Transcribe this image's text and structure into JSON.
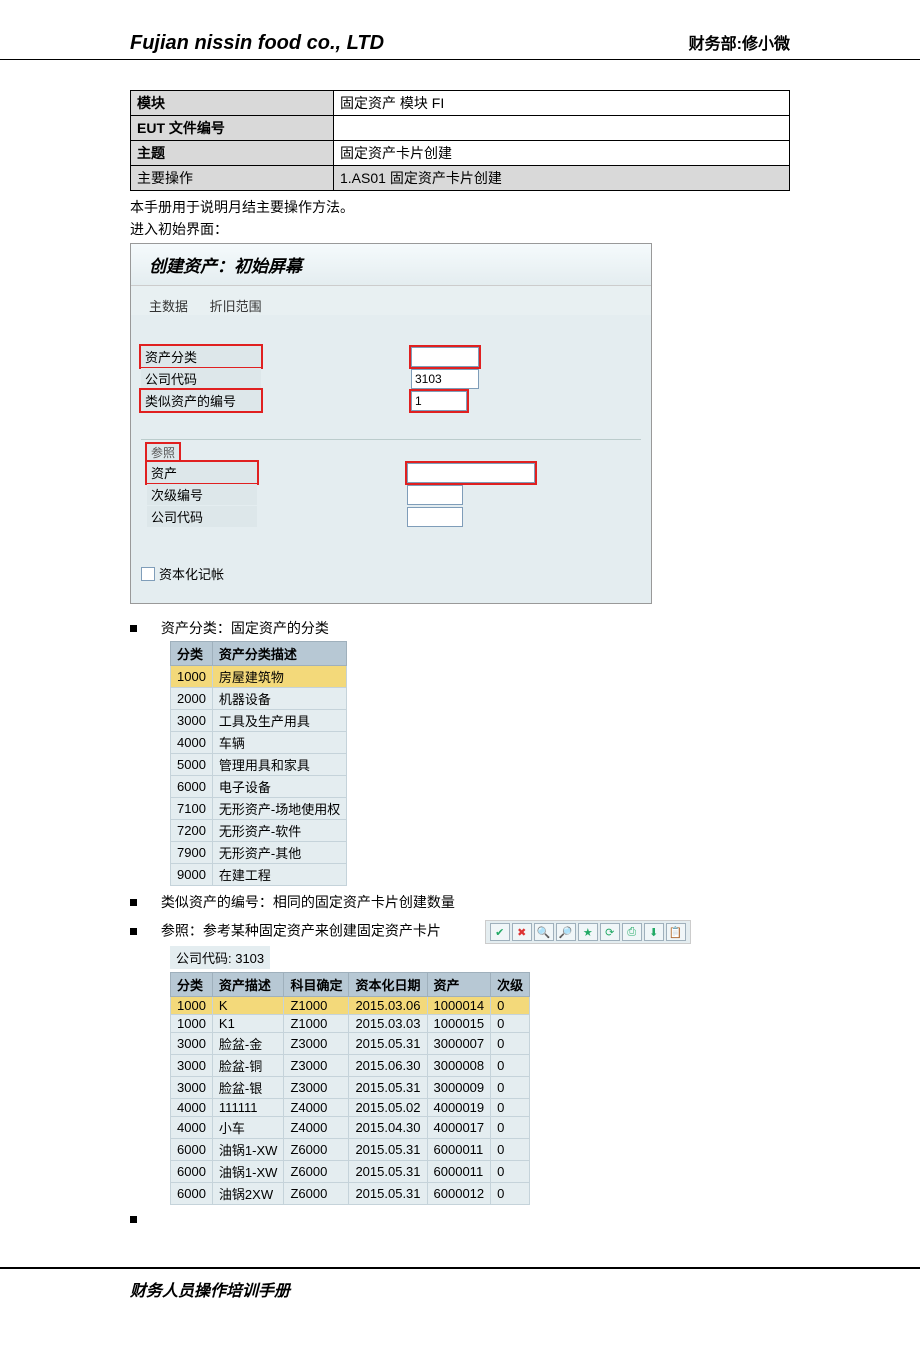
{
  "header": {
    "company": "Fujian nissin food co., LTD",
    "dept": "财务部:修小微"
  },
  "meta": {
    "module_label": "模块",
    "module_value": "固定资产 模块 FI",
    "eut_label": "EUT 文件编号",
    "eut_value": "",
    "subject_label": "主题",
    "subject_value": "固定资产卡片创建",
    "op_label": "主要操作",
    "op_value": "1.AS01 固定资产卡片创建"
  },
  "intro_line1": "本手册用于说明月结主要操作方法。",
  "intro_line2": "进入初始界面：",
  "sap_screen": {
    "title": "创建资产：初始屏幕",
    "tab_main": "主数据",
    "tab_depr": "折旧范围",
    "asset_class_label": "资产分类",
    "company_code_label": "公司代码",
    "company_code_value": "3103",
    "similar_asset_label": "类似资产的编号",
    "similar_asset_value": "1",
    "ref_header": "参照",
    "ref_asset_label": "资产",
    "ref_subno_label": "次级编号",
    "ref_company_label": "公司代码",
    "capitalize_label": "资本化记帐"
  },
  "bullets": {
    "b1": "资产分类：固定资产的分类",
    "b2": "类似资产的编号：相同的固定资产卡片创建数量",
    "b3": "参照：参考某种固定资产来创建固定资产卡片"
  },
  "class_table": {
    "h1": "分类",
    "h2": "资产分类描述",
    "rows": [
      {
        "c1": "1000",
        "c2": "房屋建筑物"
      },
      {
        "c1": "2000",
        "c2": "机器设备"
      },
      {
        "c1": "3000",
        "c2": "工具及生产用具"
      },
      {
        "c1": "4000",
        "c2": "车辆"
      },
      {
        "c1": "5000",
        "c2": "管理用具和家具"
      },
      {
        "c1": "6000",
        "c2": "电子设备"
      },
      {
        "c1": "7100",
        "c2": "无形资产-场地使用权"
      },
      {
        "c1": "7200",
        "c2": "无形资产-软件"
      },
      {
        "c1": "7900",
        "c2": "无形资产-其他"
      },
      {
        "c1": "9000",
        "c2": "在建工程"
      }
    ]
  },
  "company_code_line": "公司代码: 3103",
  "asset_list": {
    "h1": "分类",
    "h2": "资产描述",
    "h3": "科目确定",
    "h4": "资本化日期",
    "h5": "资产",
    "h6": "次级",
    "rows": [
      {
        "c1": "1000",
        "c2": "K",
        "c3": "Z1000",
        "c4": "2015.03.06",
        "c5": "1000014",
        "c6": "0",
        "sel": true
      },
      {
        "c1": "1000",
        "c2": "K1",
        "c3": "Z1000",
        "c4": "2015.03.03",
        "c5": "1000015",
        "c6": "0"
      },
      {
        "c1": "3000",
        "c2": "脸盆-金",
        "c3": "Z3000",
        "c4": "2015.05.31",
        "c5": "3000007",
        "c6": "0"
      },
      {
        "c1": "3000",
        "c2": "脸盆-铜",
        "c3": "Z3000",
        "c4": "2015.06.30",
        "c5": "3000008",
        "c6": "0"
      },
      {
        "c1": "3000",
        "c2": "脸盆-银",
        "c3": "Z3000",
        "c4": "2015.05.31",
        "c5": "3000009",
        "c6": "0"
      },
      {
        "c1": "4000",
        "c2": "111111",
        "c3": "Z4000",
        "c4": "2015.05.02",
        "c5": "4000019",
        "c6": "0"
      },
      {
        "c1": "4000",
        "c2": "小车",
        "c3": "Z4000",
        "c4": "2015.04.30",
        "c5": "4000017",
        "c6": "0"
      },
      {
        "c1": "6000",
        "c2": "油锅1-XW",
        "c3": "Z6000",
        "c4": "2015.05.31",
        "c5": "6000011",
        "c6": "0"
      },
      {
        "c1": "6000",
        "c2": "油锅1-XW",
        "c3": "Z6000",
        "c4": "2015.05.31",
        "c5": "6000011",
        "c6": "0"
      },
      {
        "c1": "6000",
        "c2": "油锅2XW",
        "c3": "Z6000",
        "c4": "2015.05.31",
        "c5": "6000012",
        "c6": "0"
      }
    ]
  },
  "toolbar_icons": [
    "check-icon",
    "close-icon",
    "search-icon",
    "search-plus-icon",
    "star-icon",
    "refresh-icon",
    "print-icon",
    "download-icon",
    "clipboard-icon"
  ],
  "footer": "财务人员操作培训手册"
}
